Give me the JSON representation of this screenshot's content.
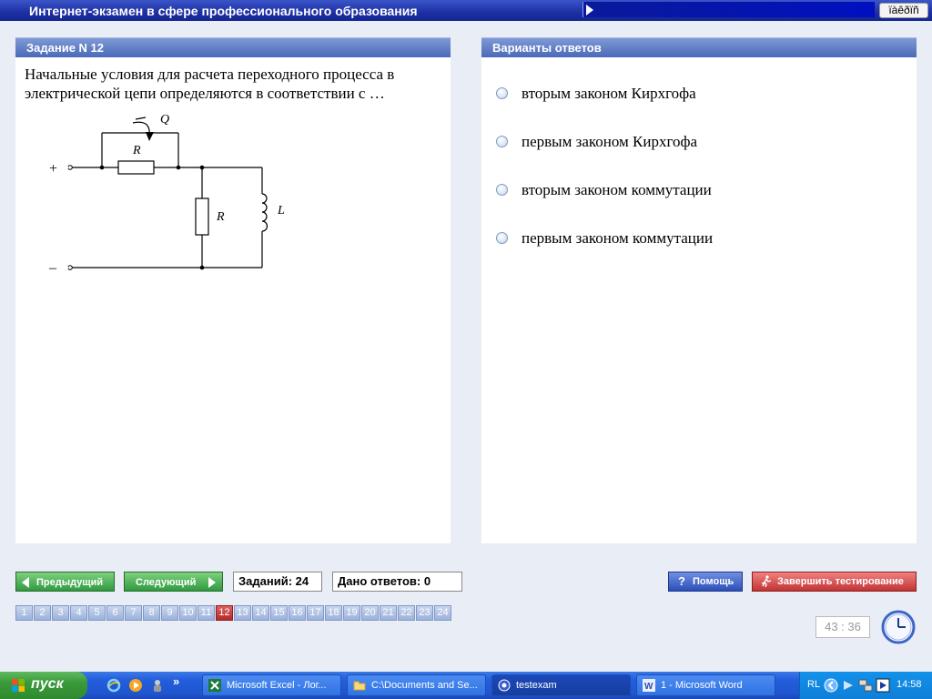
{
  "app": {
    "title": "Интернет-экзамен в сфере профессионального образования",
    "lang_indicator": "ïàêðïñ"
  },
  "task_panel": {
    "header": "Задание N 12",
    "question": "Начальные условия для расчета переходного процесса в электрической цепи определяются в соответствии с …",
    "circuit": {
      "switch_label": "Q",
      "top_resistor_label": "R",
      "middle_resistor_label": "R",
      "inductor_label": "L",
      "plus": "+",
      "minus": "–"
    }
  },
  "answers_panel": {
    "header": "Варианты ответов",
    "options": [
      "вторым законом Кирхгофа",
      "первым законом Кирхгофа",
      "вторым законом коммутации",
      "первым законом коммутации"
    ]
  },
  "controls": {
    "prev_label": "Предыдущий",
    "next_label": "Следующий",
    "tasks_total": "Заданий: 24",
    "answers_given": "Дано ответов: 0",
    "help_label": "Помощь",
    "finish_label": "Завершить тестирование"
  },
  "pager": {
    "pages": [
      "1",
      "2",
      "3",
      "4",
      "5",
      "6",
      "7",
      "8",
      "9",
      "10",
      "11",
      "12",
      "13",
      "14",
      "15",
      "16",
      "17",
      "18",
      "19",
      "20",
      "21",
      "22",
      "23",
      "24"
    ],
    "active": "12"
  },
  "timer": "43 : 36",
  "taskbar": {
    "start_label": "пуск",
    "quicklaunch_more": "»",
    "items": [
      {
        "label": "Microsoft Excel - Лог...",
        "icon": "excel-icon"
      },
      {
        "label": "C:\\Documents and Se...",
        "icon": "folder-icon"
      },
      {
        "label": "testexam",
        "icon": "app-icon",
        "active": true
      },
      {
        "label": "1 - Microsoft Word",
        "icon": "word-icon"
      }
    ],
    "tray_lang": "RL",
    "clock": "14:58"
  },
  "colors": {
    "title_bar": "#1d2fa3",
    "panel_header": "#4a69b8",
    "nav_green": "#2f9a3f",
    "finish_red": "#c23434",
    "active_page": "#b52a2a",
    "taskbar_blue": "#245edc"
  }
}
